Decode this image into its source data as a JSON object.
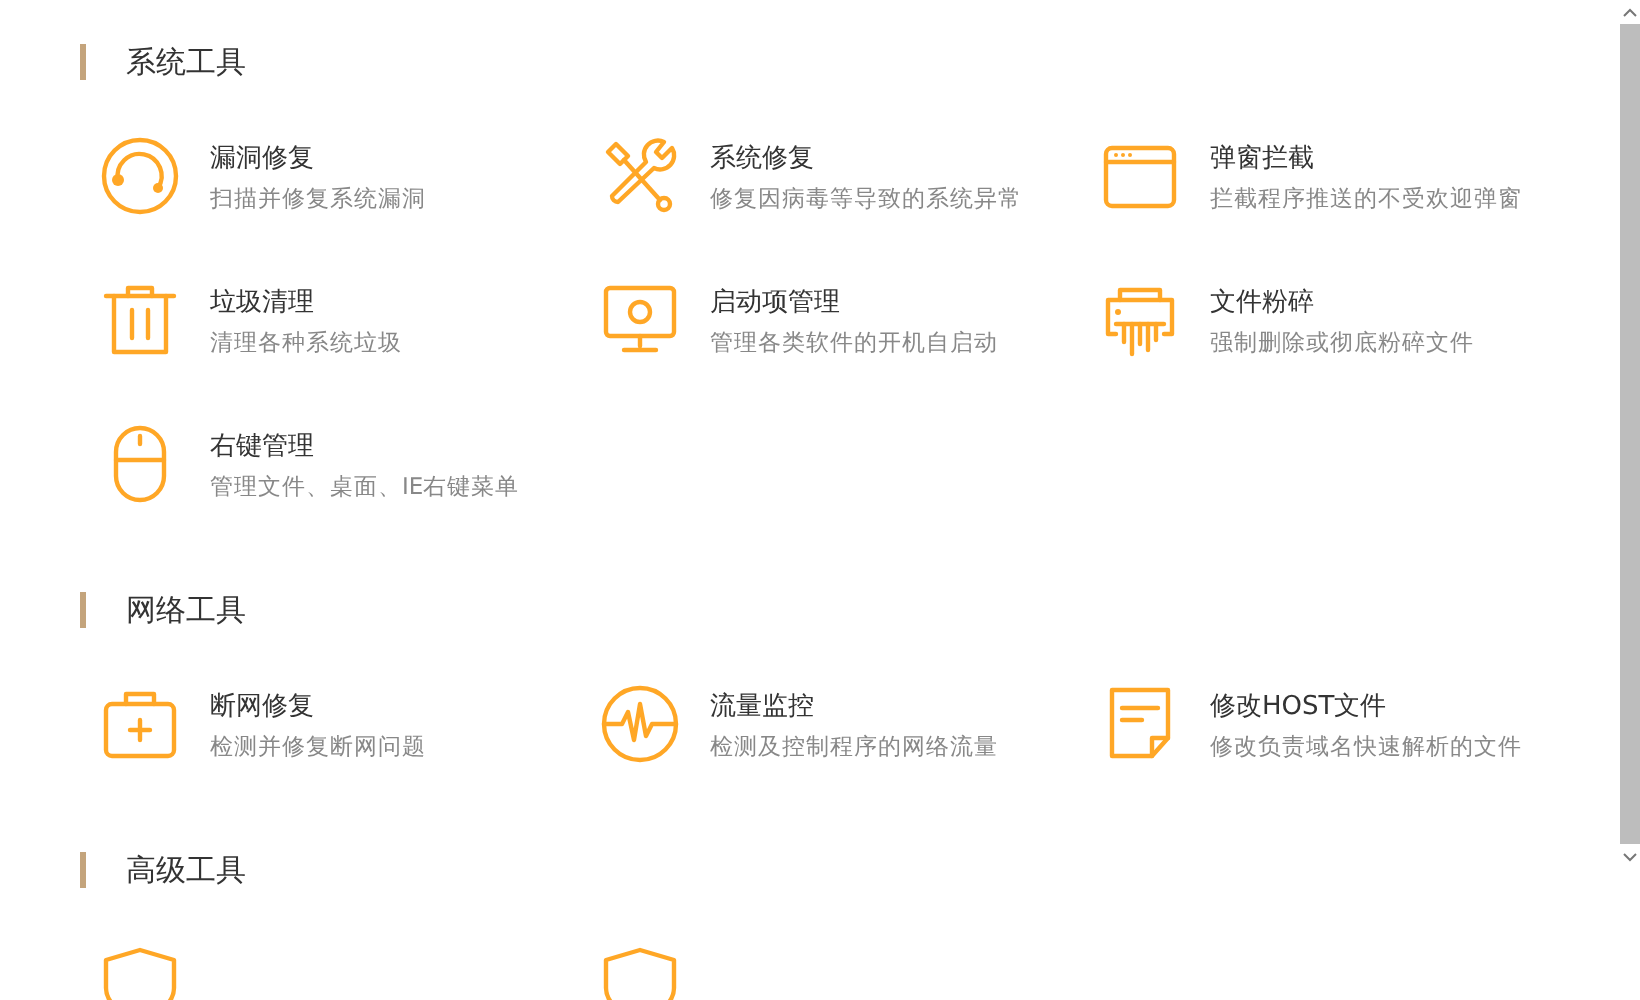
{
  "sections": [
    {
      "title": "系统工具",
      "items": [
        {
          "kind": "lifebuoy",
          "title": "漏洞修复",
          "desc": "扫描并修复系统漏洞"
        },
        {
          "kind": "tools",
          "title": "系统修复",
          "desc": "修复因病毒等导致的系统异常"
        },
        {
          "kind": "window",
          "title": "弹窗拦截",
          "desc": "拦截程序推送的不受欢迎弹窗"
        },
        {
          "kind": "trash",
          "title": "垃圾清理",
          "desc": "清理各种系统垃圾"
        },
        {
          "kind": "monitor",
          "title": "启动项管理",
          "desc": "管理各类软件的开机自启动"
        },
        {
          "kind": "shredder",
          "title": "文件粉碎",
          "desc": "强制删除或彻底粉碎文件"
        },
        {
          "kind": "mouse",
          "title": "右键管理",
          "desc": "管理文件、桌面、IE右键菜单"
        }
      ]
    },
    {
      "title": "网络工具",
      "items": [
        {
          "kind": "medkit",
          "title": "断网修复",
          "desc": "检测并修复断网问题"
        },
        {
          "kind": "pulse",
          "title": "流量监控",
          "desc": "检测及控制程序的网络流量"
        },
        {
          "kind": "note",
          "title": "修改HOST文件",
          "desc": "修改负责域名快速解析的文件"
        }
      ]
    },
    {
      "title": "高级工具",
      "items": [
        {
          "kind": "shield"
        },
        {
          "kind": "shield"
        }
      ]
    }
  ]
}
